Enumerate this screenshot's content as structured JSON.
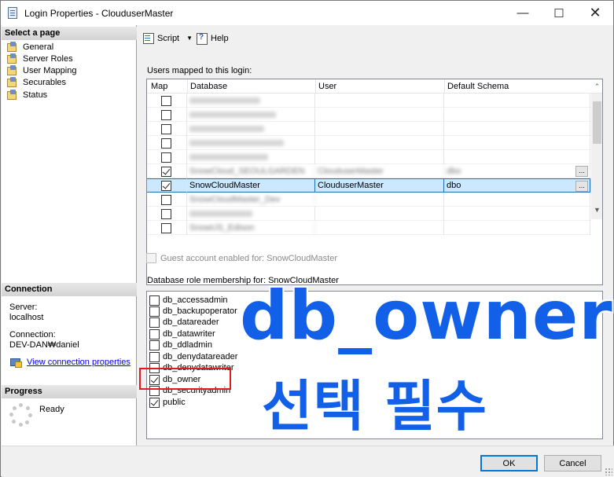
{
  "window": {
    "title": "Login Properties - ClouduserMaster",
    "minimize_glyph": "—",
    "maximize_glyph": "☐",
    "close_glyph": "✕"
  },
  "sidebar": {
    "select_page_header": "Select a page",
    "pages": [
      {
        "label": "General",
        "icon": "wrench-page-icon"
      },
      {
        "label": "Server Roles",
        "icon": "wrench-page-icon"
      },
      {
        "label": "User Mapping",
        "icon": "wrench-page-icon"
      },
      {
        "label": "Securables",
        "icon": "wrench-page-icon"
      },
      {
        "label": "Status",
        "icon": "wrench-page-icon"
      }
    ],
    "connection_header": "Connection",
    "server_label": "Server:",
    "server_value": "localhost",
    "connection_label": "Connection:",
    "connection_value": "DEV-DAN₩daniel",
    "view_connection_link": "View connection properties",
    "progress_header": "Progress",
    "progress_status": "Ready"
  },
  "toolbar": {
    "script_label": "Script",
    "script_dropdown_glyph": "▼",
    "help_label": "Help"
  },
  "mapping": {
    "section_label": "Users mapped to this login:",
    "columns": [
      "Map",
      "Database",
      "User",
      "Default Schema"
    ],
    "rows": [
      {
        "checked": false,
        "database": "",
        "user": "",
        "schema": "",
        "blurred": true
      },
      {
        "checked": false,
        "database": "",
        "user": "",
        "schema": "",
        "blurred": true
      },
      {
        "checked": false,
        "database": "",
        "user": "",
        "schema": "",
        "blurred": true
      },
      {
        "checked": false,
        "database": "",
        "user": "",
        "schema": "",
        "blurred": true
      },
      {
        "checked": false,
        "database": "",
        "user": "",
        "schema": "",
        "blurred": true
      },
      {
        "checked": true,
        "database": "SnowCloud_SEOULGARDEN",
        "user": "ClouduserMaster",
        "schema": "dbo",
        "blurred": true
      },
      {
        "checked": true,
        "database": "SnowCloudMaster",
        "user": "ClouduserMaster",
        "schema": "dbo",
        "blurred": false,
        "selected": true
      },
      {
        "checked": false,
        "database": "SnowCloudMaster_Dev",
        "user": "",
        "schema": "",
        "blurred": true
      },
      {
        "checked": false,
        "database": "",
        "user": "",
        "schema": "",
        "blurred": true
      },
      {
        "checked": false,
        "database": "SnowUS_Edison",
        "user": "",
        "schema": "",
        "blurred": true
      }
    ],
    "ellipsis_label": "...",
    "scroll_up_glyph": "▲",
    "scroll_down_glyph": "▼",
    "header_scroll_glyph": "⌃"
  },
  "guest": {
    "label": "Guest account enabled for: SnowCloudMaster",
    "checked": false,
    "disabled": true
  },
  "roles": {
    "section_label": "Database role membership for: SnowCloudMaster",
    "items": [
      {
        "label": "db_accessadmin",
        "checked": false
      },
      {
        "label": "db_backupoperator",
        "checked": false
      },
      {
        "label": "db_datareader",
        "checked": false
      },
      {
        "label": "db_datawriter",
        "checked": false
      },
      {
        "label": "db_ddladmin",
        "checked": false
      },
      {
        "label": "db_denydatareader",
        "checked": false
      },
      {
        "label": "db_denydatawriter",
        "checked": false
      },
      {
        "label": "db_owner",
        "checked": true
      },
      {
        "label": "db_securityadmin",
        "checked": false
      },
      {
        "label": "public",
        "checked": true
      }
    ]
  },
  "annotation": {
    "line1": "db_owner",
    "line2": "선택 필수",
    "color": "#1260e8",
    "highlight_color": "#e11b1b"
  },
  "footer": {
    "ok_label": "OK",
    "cancel_label": "Cancel"
  }
}
